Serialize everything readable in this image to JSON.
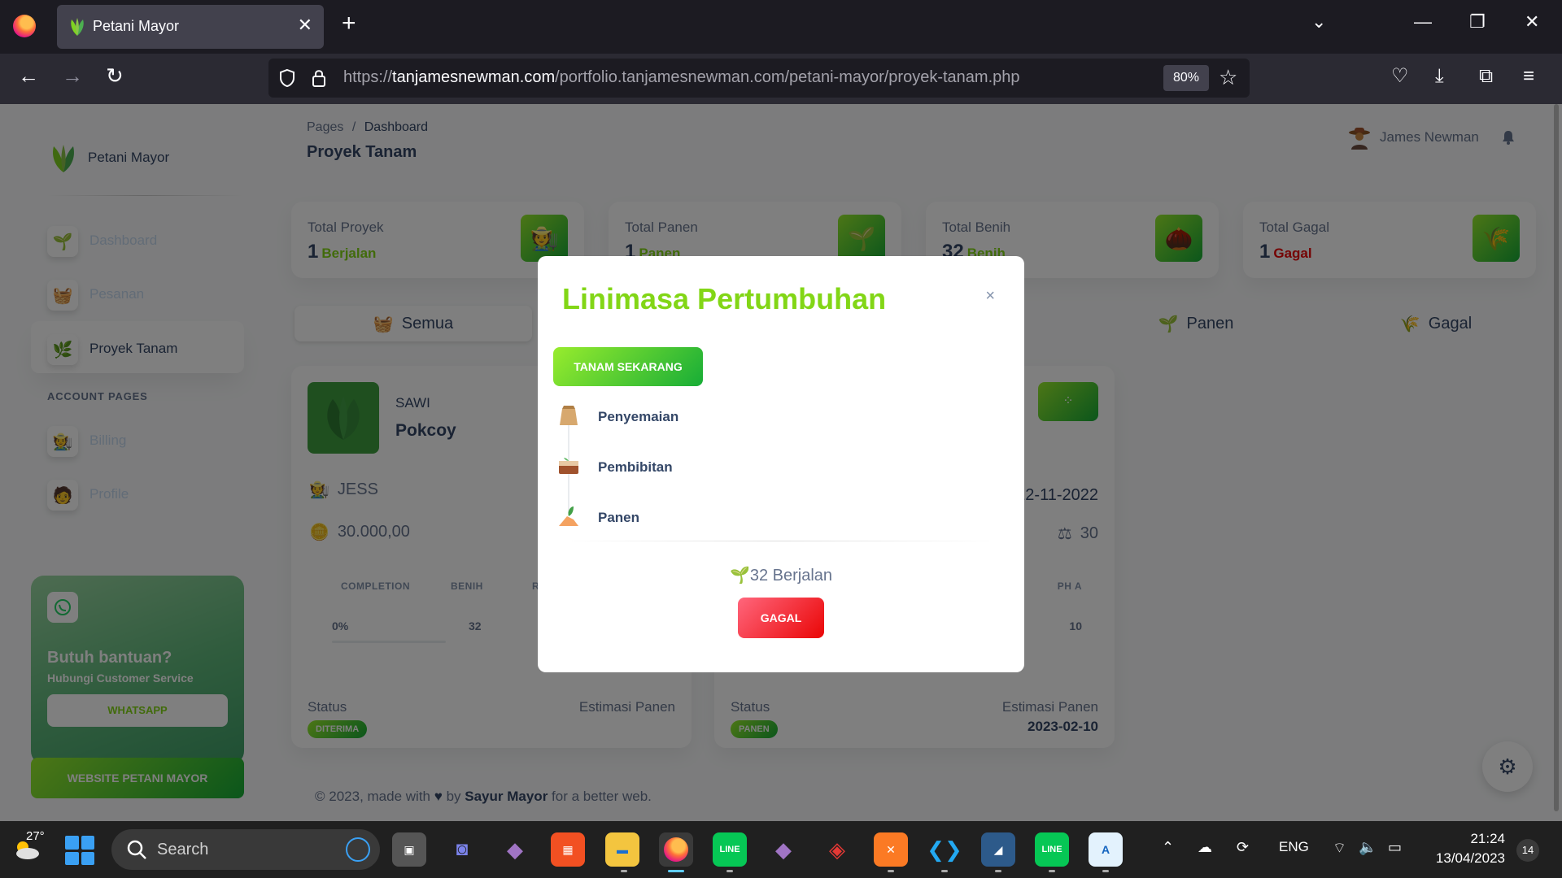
{
  "browser": {
    "tab_title": "Petani Mayor",
    "url_domain": "tanjamesnewman.com",
    "url_prefix": "https://",
    "url_path": "/portfolio.tanjamesnewman.com/petani-mayor/proyek-tanam.php",
    "zoom": "80%"
  },
  "sidebar": {
    "brand": "Petani Mayor",
    "items": [
      {
        "label": "Dashboard",
        "icon": "plant-icon"
      },
      {
        "label": "Pesanan",
        "icon": "basket-icon"
      },
      {
        "label": "Proyek Tanam",
        "icon": "farm-icon"
      }
    ],
    "account_heading": "ACCOUNT PAGES",
    "account_items": [
      {
        "label": "Billing",
        "icon": "billing-icon"
      },
      {
        "label": "Profile",
        "icon": "profile-icon"
      }
    ],
    "help": {
      "title": "Butuh bantuan?",
      "subtitle": "Hubungi Customer Service",
      "button": "WHATSAPP"
    },
    "site_button": "WEBSITE PETANI MAYOR"
  },
  "header": {
    "breadcrumb_root": "Pages",
    "breadcrumb_sep": "/",
    "breadcrumb_current": "Dashboard",
    "title": "Proyek Tanam",
    "user_name": "James Newman"
  },
  "stats": [
    {
      "label": "Total Proyek",
      "value": "1",
      "unit": "Berjalan"
    },
    {
      "label": "Total Panen",
      "value": "1",
      "unit": "Panen"
    },
    {
      "label": "Total Benih",
      "value": "32",
      "unit": "Benih"
    },
    {
      "label": "Total Gagal",
      "value": "1",
      "unit": "Gagal"
    }
  ],
  "filters": [
    {
      "label": "Semua"
    },
    {
      "label": "Panen"
    },
    {
      "label": "Gagal"
    }
  ],
  "projects": [
    {
      "category": "SAWI",
      "name": "Pokcoy",
      "owner": "JESS",
      "price": "30.000,00",
      "col_completion": "COMPLETION",
      "col_benih": "BENIH",
      "col_r": "R",
      "completion": "0%",
      "benih": "32",
      "status_label": "Status",
      "status": "DITERIMA",
      "estimate_label": "Estimasi Panen"
    },
    {
      "date": "22-11-2022",
      "weight": "30",
      "col_ph": "PH A",
      "ph": "10",
      "status_label": "Status",
      "status": "PANEN",
      "estimate_label": "Estimasi Panen",
      "estimate": "2023-02-10"
    }
  ],
  "footer": {
    "prefix": "© 2023, made with",
    "by": "by",
    "author": "Sayur Mayor",
    "suffix": "for a better web."
  },
  "modal": {
    "title": "Linimasa Pertumbuhan",
    "close": "×",
    "plant_button": "TANAM SEKARANG",
    "timeline": [
      {
        "label": "Penyemaian"
      },
      {
        "label": "Pembibitan"
      },
      {
        "label": "Panen"
      }
    ],
    "count": "32 Berjalan",
    "fail_button": "GAGAL"
  },
  "taskbar": {
    "temperature": "27°",
    "search": "Search",
    "language": "ENG",
    "time": "21:24",
    "date": "13/04/2023",
    "notifications": "14"
  },
  "colors": {
    "accent_green": "#82d616",
    "fail_red": "#ea0606",
    "text_dark": "#344767"
  }
}
